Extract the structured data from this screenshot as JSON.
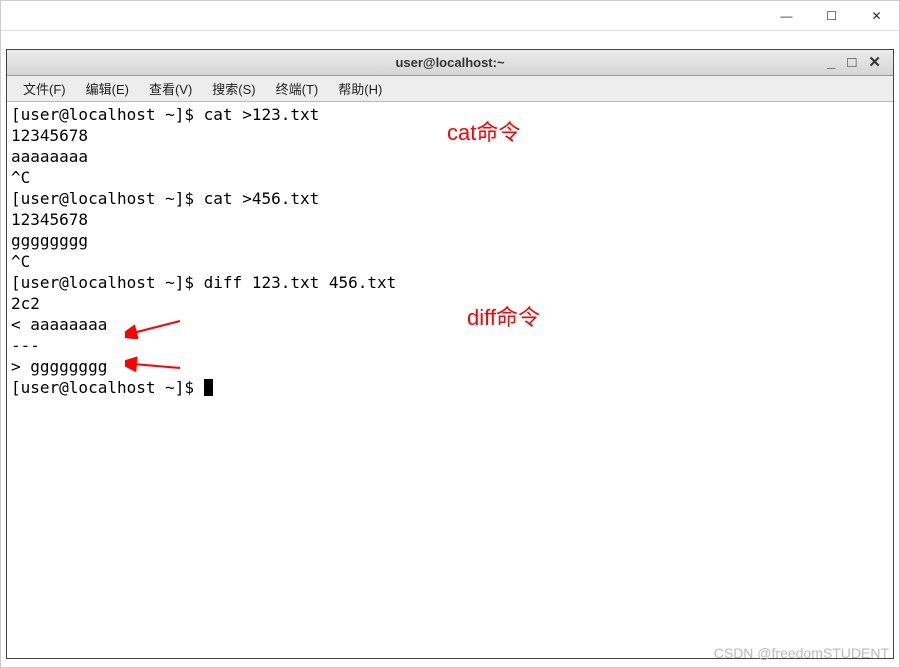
{
  "outer_window": {
    "minimize": "—",
    "maximize": "☐",
    "close": "✕"
  },
  "inner_window": {
    "title": "user@localhost:~",
    "minimize": "_",
    "maximize": "□",
    "close": "✕"
  },
  "menu": {
    "file": "文件(F)",
    "edit": "编辑(E)",
    "view": "查看(V)",
    "search": "搜索(S)",
    "terminal": "终端(T)",
    "help": "帮助(H)"
  },
  "terminal": {
    "lines": [
      "[user@localhost ~]$ cat >123.txt",
      "12345678",
      "aaaaaaaa",
      "^C",
      "[user@localhost ~]$ cat >456.txt",
      "12345678",
      "gggggggg",
      "^C",
      "[user@localhost ~]$ diff 123.txt 456.txt",
      "2c2",
      "< aaaaaaaa",
      "---",
      "> gggggggg",
      "[user@localhost ~]$ "
    ]
  },
  "annotations": {
    "cat_label": "cat命令",
    "diff_label": "diff命令"
  },
  "watermark": "CSDN @freedomSTUDENT"
}
